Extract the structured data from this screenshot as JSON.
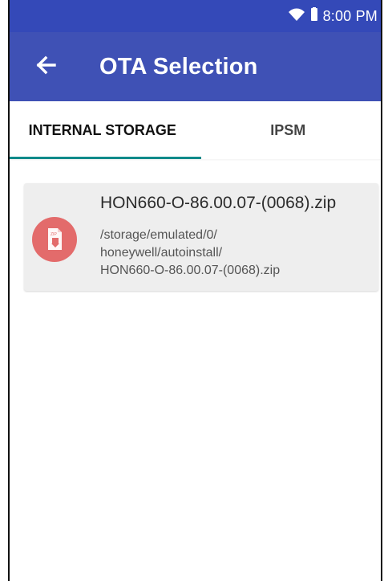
{
  "status_bar": {
    "time": "8:00 PM",
    "icons": [
      "wifi-icon",
      "battery-icon"
    ]
  },
  "app_bar": {
    "title": "OTA Selection",
    "back_icon": "back-arrow-icon"
  },
  "tabs": [
    {
      "label": "INTERNAL STORAGE",
      "selected": true
    },
    {
      "label": "IPSM",
      "selected": false
    }
  ],
  "file_item": {
    "icon": "zip-file-icon",
    "name": "HON660-O-86.00.07-(0068).zip",
    "path_lines": [
      "/storage/emulated/0/",
      "honeywell/autoinstall/",
      "HON660-O-86.00.07-(0068).zip"
    ]
  },
  "colors": {
    "status_bar": "#3449b8",
    "app_bar": "#3f51b5",
    "tab_indicator": "#0f8a8a",
    "card_bg": "#eeeeee",
    "icon_bg": "#e36b6b"
  }
}
